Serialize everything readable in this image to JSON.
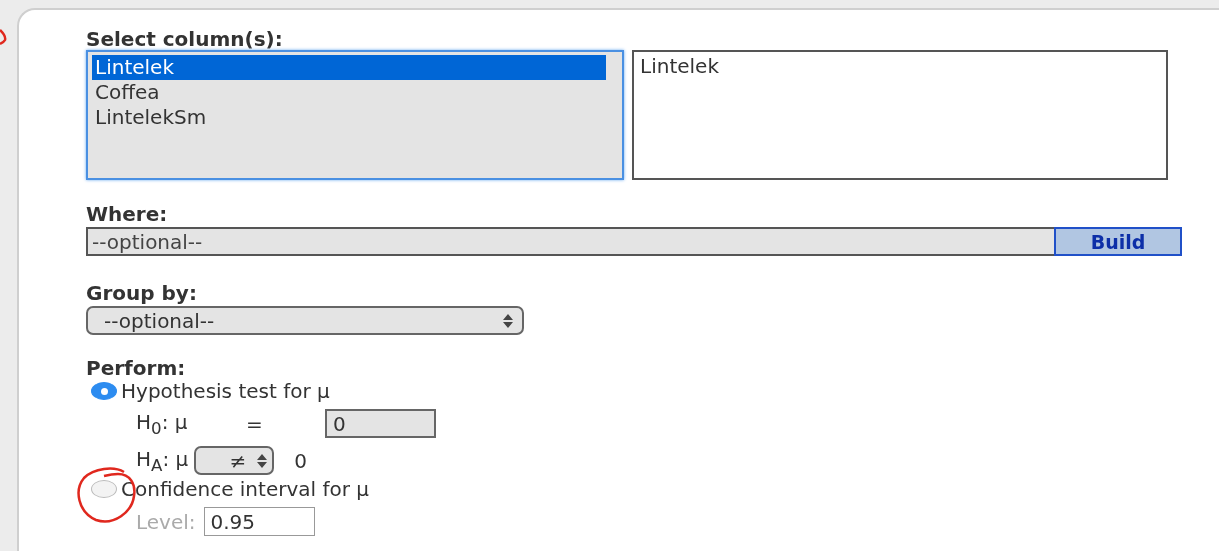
{
  "columns": {
    "label": "Select column(s):",
    "items": [
      {
        "label": "Lintelek",
        "selected": true
      },
      {
        "label": "Coffea",
        "selected": false
      },
      {
        "label": "LintelekSm",
        "selected": false
      }
    ],
    "chosen": [
      "Lintelek"
    ]
  },
  "where": {
    "label": "Where:",
    "placeholder": "--optional--",
    "button": "Build"
  },
  "group_by": {
    "label": "Group by:",
    "value": "--optional--"
  },
  "perform": {
    "label": "Perform:",
    "options": [
      {
        "kind": "hypothesis",
        "label": "Hypothesis test for μ",
        "selected": true,
        "h0": "H$_{0}$: μ",
        "h0_op": "=",
        "h0_value": "0",
        "ha": "H$_{A}$: μ",
        "ha_op": "≠",
        "ha_value": "0"
      },
      {
        "kind": "interval",
        "label": "Confidence interval for μ",
        "selected": false,
        "level_label": "Level:",
        "level_disabled": true,
        "level_value": "0.95"
      }
    ]
  }
}
